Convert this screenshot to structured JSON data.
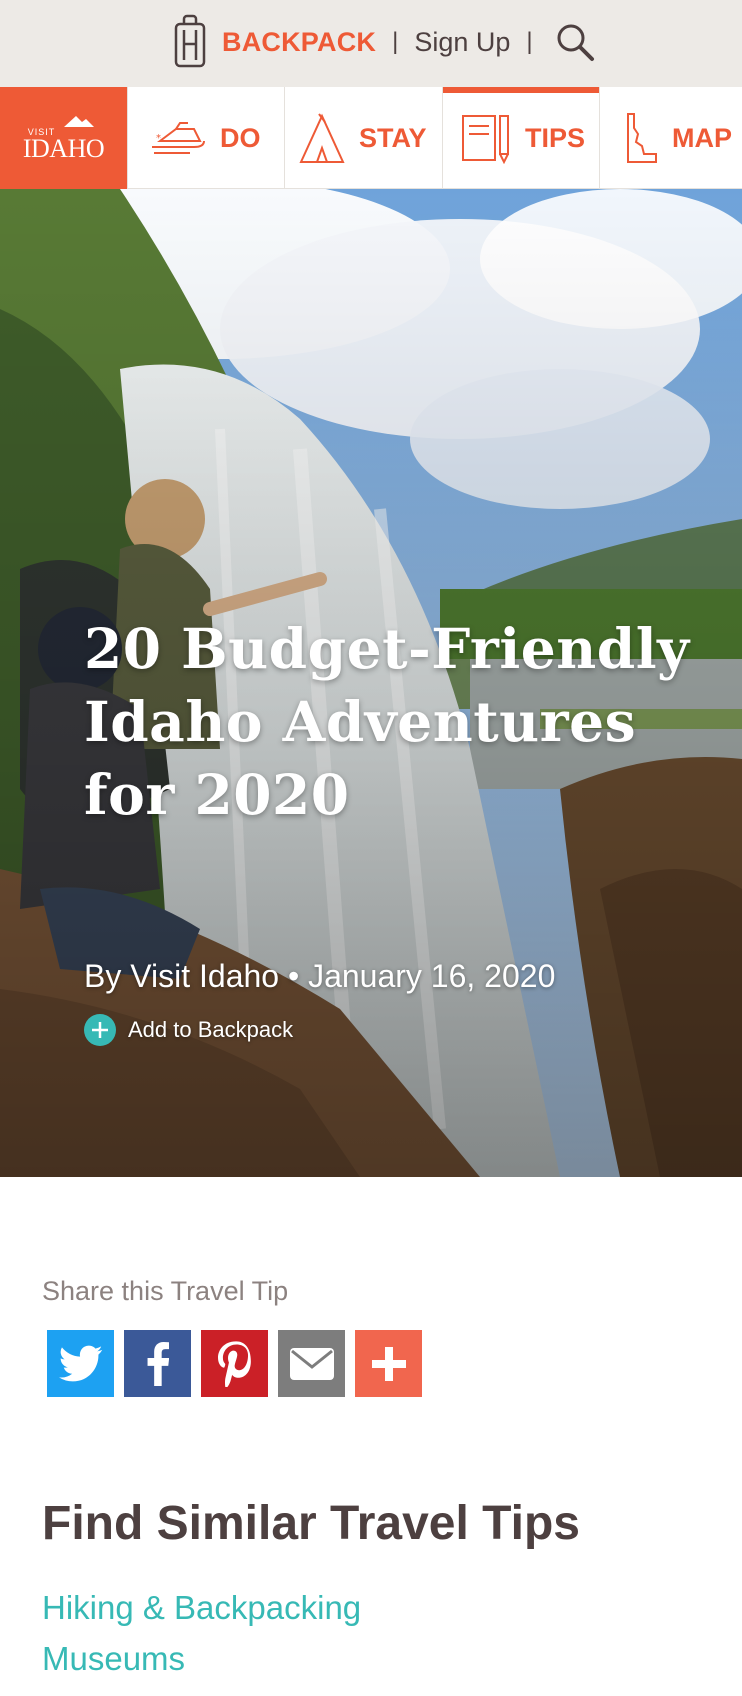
{
  "utility": {
    "backpack_label": "BACKPACK",
    "separator": "|",
    "signup_label": "Sign Up"
  },
  "nav": {
    "logo": {
      "visit": "VISIT",
      "idaho": "IDAHO"
    },
    "items": [
      {
        "label": "DO",
        "icon": "snowmobile-icon"
      },
      {
        "label": "STAY",
        "icon": "tent-icon"
      },
      {
        "label": "TIPS",
        "icon": "notebook-pencil-icon",
        "active": true
      },
      {
        "label": "MAP",
        "icon": "idaho-state-icon"
      }
    ]
  },
  "hero": {
    "title": "20 Budget-Friendly Idaho Adventures for 2020",
    "byline": "By Visit Idaho • January 16, 2020",
    "add_to_backpack": "Add to Backpack"
  },
  "share": {
    "heading": "Share this Travel Tip",
    "buttons": [
      {
        "icon": "twitter-icon",
        "color": "#1da1f2"
      },
      {
        "icon": "facebook-icon",
        "color": "#3b5998"
      },
      {
        "icon": "pinterest-icon",
        "color": "#cb2027"
      },
      {
        "icon": "email-icon",
        "color": "#7d7d7d"
      },
      {
        "icon": "plus-icon",
        "color": "#f1664e"
      }
    ]
  },
  "similar": {
    "heading": "Find Similar Travel Tips",
    "links": [
      "Hiking & Backpacking",
      "Museums"
    ]
  },
  "colors": {
    "brand_orange": "#ee5a36",
    "teal_link": "#37b9b5",
    "text_dark": "#4d4040",
    "utility_bg": "#edeae6"
  }
}
